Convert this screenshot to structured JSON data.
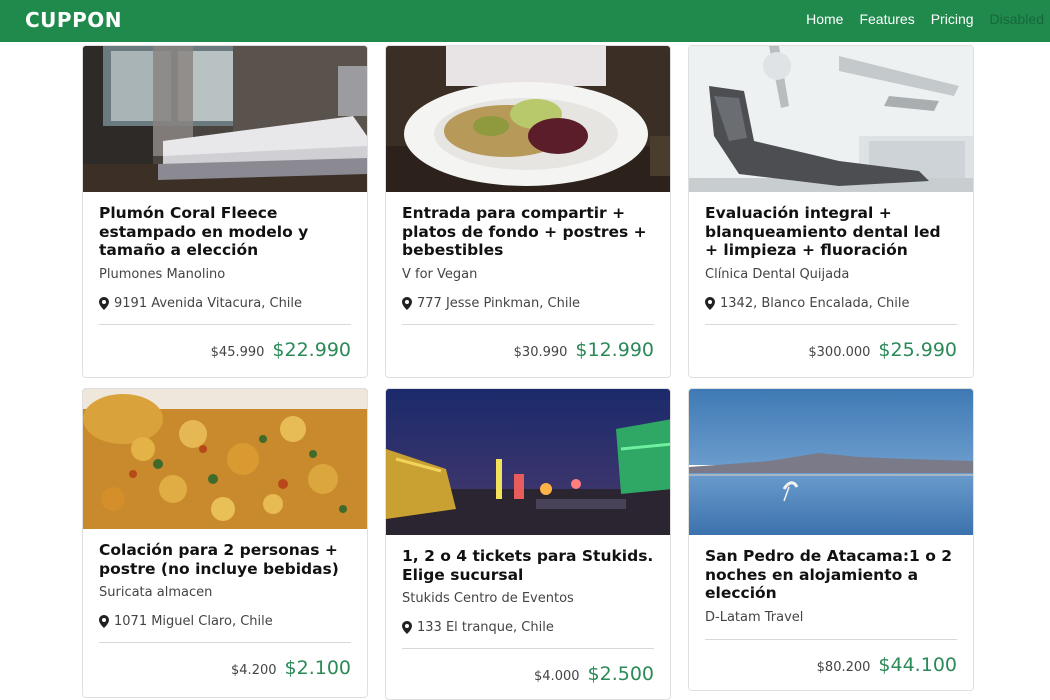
{
  "navbar": {
    "brand": "CUPPON",
    "links": [
      {
        "label": "Home"
      },
      {
        "label": "Features"
      },
      {
        "label": "Pricing"
      },
      {
        "label": "Disabled"
      }
    ]
  },
  "colors": {
    "navbar": "#1f8a4c",
    "price": "#2b8a57"
  },
  "cards": [
    {
      "title": "Plumón Coral Fleece estampado en modelo y tamaño a elección",
      "store": "Plumones Manolino",
      "location": "9191 Avenida Vitacura, Chile",
      "old_price": "$45.990",
      "new_price": "$22.990"
    },
    {
      "title": "Entrada para compartir + platos de fondo + postres + bebestibles",
      "store": "V for Vegan",
      "location": "777 Jesse Pinkman, Chile",
      "old_price": "$30.990",
      "new_price": "$12.990"
    },
    {
      "title": "Evaluación integral + blanqueamiento dental led + limpieza + fluoración",
      "store": "Clínica Dental Quijada",
      "location": "1342, Blanco Encalada, Chile",
      "old_price": "$300.000",
      "new_price": "$25.990"
    },
    {
      "title": "Colación para 2 personas + postre (no incluye bebidas)",
      "store": "Suricata almacen",
      "location": "1071 Miguel Claro, Chile",
      "old_price": "$4.200",
      "new_price": "$2.100"
    },
    {
      "title": "1, 2 o 4 tickets para Stukids. Elige sucursal",
      "store": "Stukids Centro de Eventos",
      "location": "133 El tranque, Chile",
      "old_price": "$4.000",
      "new_price": "$2.500"
    },
    {
      "title": "San Pedro de Atacama:1 o 2 noches en alojamiento a elección",
      "store": "D-Latam Travel",
      "location": "",
      "old_price": "$80.200",
      "new_price": "$44.100"
    }
  ]
}
